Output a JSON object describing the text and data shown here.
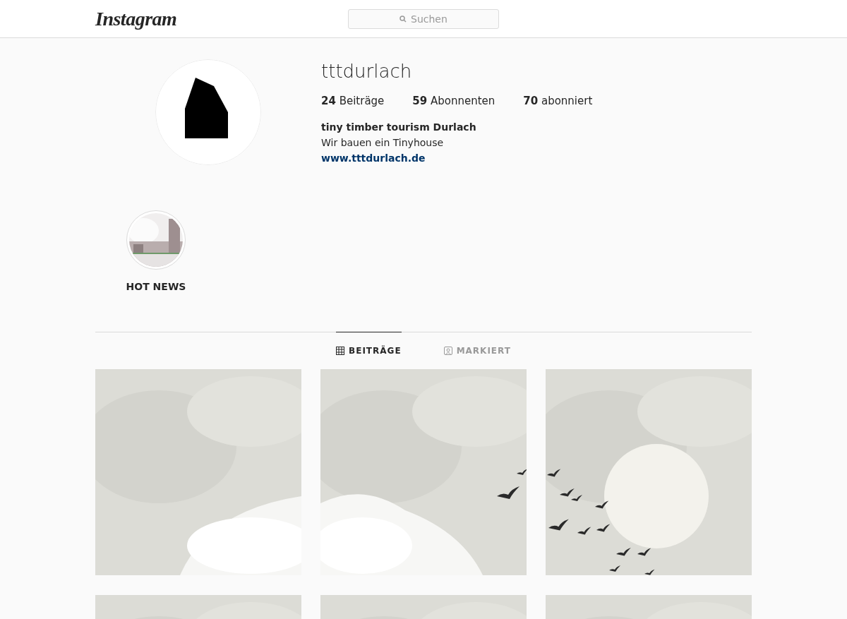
{
  "header": {
    "logo": "Instagram",
    "search": {
      "placeholder": "Suchen"
    }
  },
  "profile": {
    "username": "tttdurlach",
    "stats": [
      "**24** Beiträge",
      "**59** Abonnenten",
      "**70** abonniert"
    ],
    "full_name": "tiny timber tourism Durlach",
    "bio": "Wir bauen ein Tinyhouse",
    "website": "www.tttdurlach.de"
  },
  "highlights": [
    {
      "label": "HOT NEWS"
    }
  ],
  "tabs": [
    {
      "label": "BEITRÄGE",
      "kind": "grid",
      "selected": true
    },
    {
      "label": "MARKIERT",
      "kind": "tagged",
      "selected": false
    }
  ]
}
